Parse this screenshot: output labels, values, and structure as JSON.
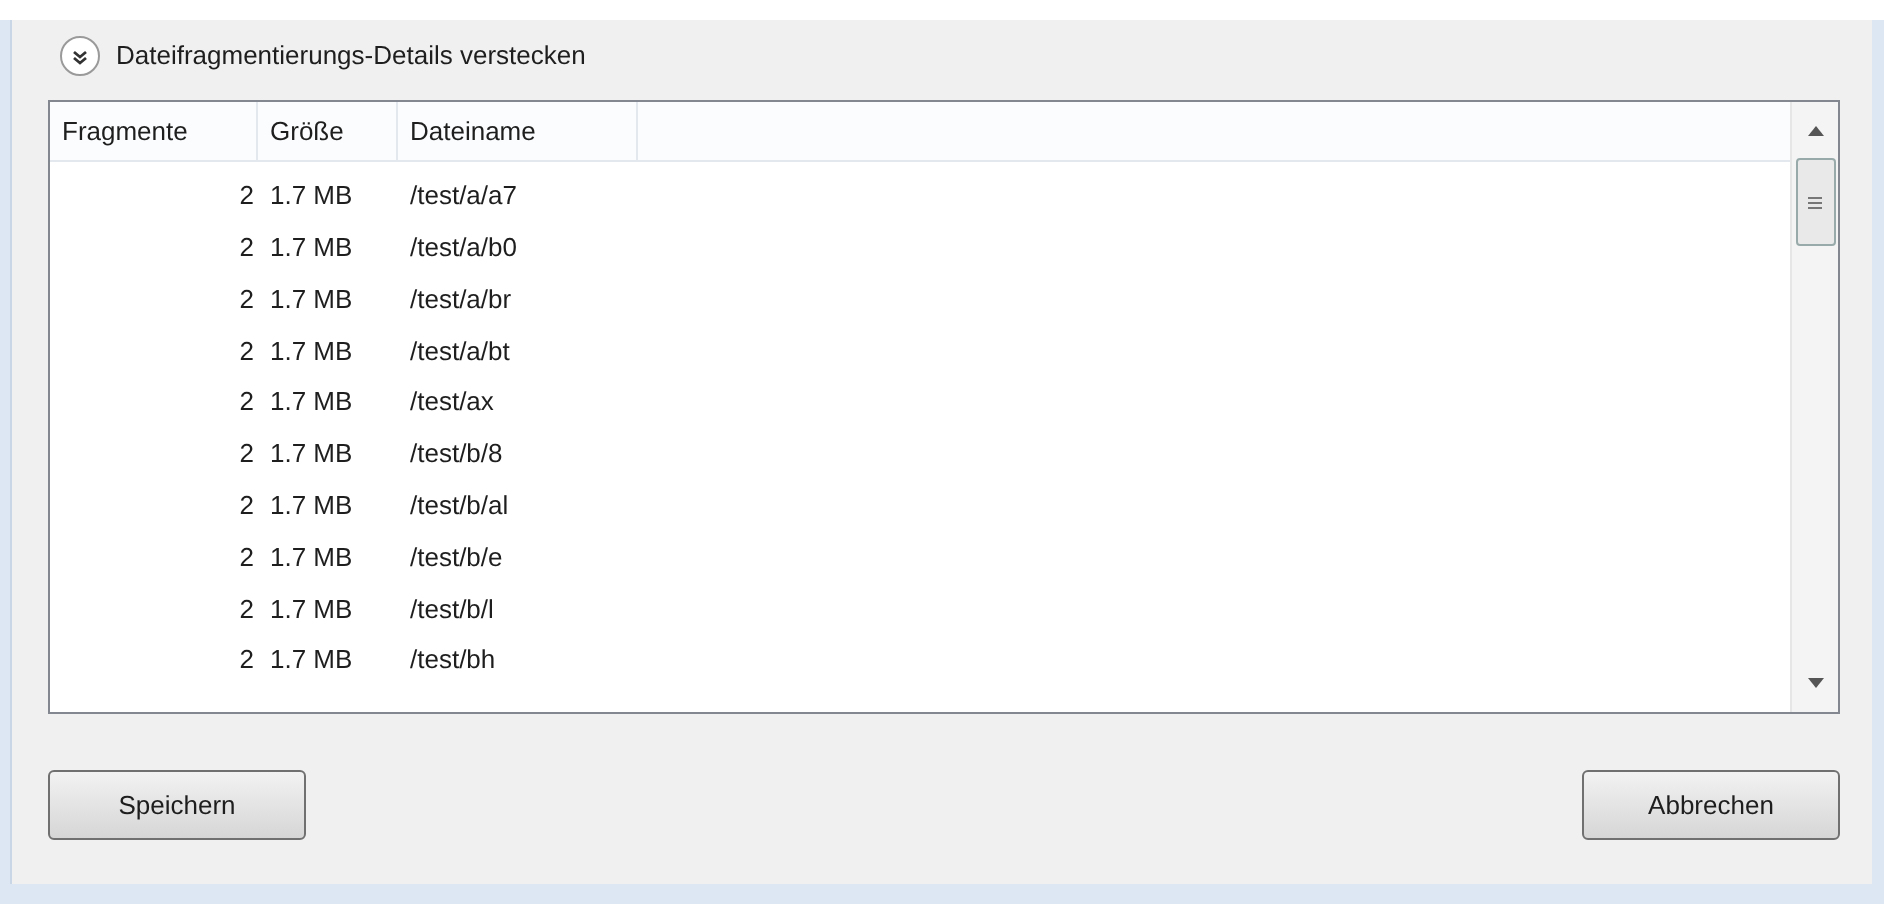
{
  "toggle": {
    "label": "Dateifragmentierungs-Details verstecken",
    "expanded": true
  },
  "table": {
    "columns": [
      "Fragmente",
      "Größe",
      "Dateiname"
    ],
    "rows": [
      {
        "fragments": "2",
        "size": "1.7 MB",
        "name": "/test/a/a7"
      },
      {
        "fragments": "2",
        "size": "1.7 MB",
        "name": "/test/a/b0"
      },
      {
        "fragments": "2",
        "size": "1.7 MB",
        "name": "/test/a/br"
      },
      {
        "fragments": "2",
        "size": "1.7 MB",
        "name": "/test/a/bt"
      },
      {
        "fragments": "2",
        "size": "1.7 MB",
        "name": "/test/ax"
      },
      {
        "fragments": "2",
        "size": "1.7 MB",
        "name": "/test/b/8"
      },
      {
        "fragments": "2",
        "size": "1.7 MB",
        "name": "/test/b/al"
      },
      {
        "fragments": "2",
        "size": "1.7 MB",
        "name": "/test/b/e"
      },
      {
        "fragments": "2",
        "size": "1.7 MB",
        "name": "/test/b/l"
      },
      {
        "fragments": "2",
        "size": "1.7 MB",
        "name": "/test/bh"
      }
    ]
  },
  "buttons": [
    "Speichern",
    "Abbrechen"
  ]
}
